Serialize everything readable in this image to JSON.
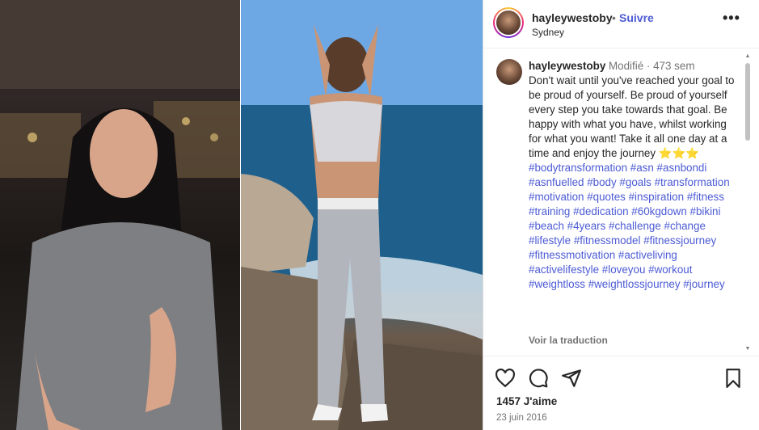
{
  "post": {
    "username": "hayleywestoby",
    "dot": "•",
    "follow_label": "Suivre",
    "location": "Sydney",
    "more_label": "•••"
  },
  "caption": {
    "username": "hayleywestoby",
    "edited": "Modifié",
    "separator": "·",
    "age": "473 sem",
    "text": "Don't wait until you've reached your goal to be proud of yourself. Be proud of yourself every step you take towards that goal. Be happy with what you have, whilst working for what you want! Take it all one day at a time and enjoy the journey",
    "emojis": "⭐⭐⭐",
    "hashtags": "#bodytransformation #asn #asnbondi #asnfuelled #body #goals #transformation #motivation #quotes #inspiration #fitness #training #dedication #60kgdown #bikini #beach #4years #challenge #change #lifestyle #fitnessmodel #fitnessjourney #fitnessmotivation #activeliving #activelifestyle #loveyou #workout #weightloss #weightlossjourney #journey",
    "see_translation": "Voir la traduction"
  },
  "actions": {
    "like_icon": "heart-icon",
    "comment_icon": "comment-icon",
    "share_icon": "send-icon",
    "save_icon": "bookmark-icon"
  },
  "stats": {
    "likes": "1457 J'aime",
    "date": "23 juin 2016"
  },
  "colors": {
    "link": "#4c5bd4",
    "secondary": "#737373",
    "text": "#262626"
  }
}
